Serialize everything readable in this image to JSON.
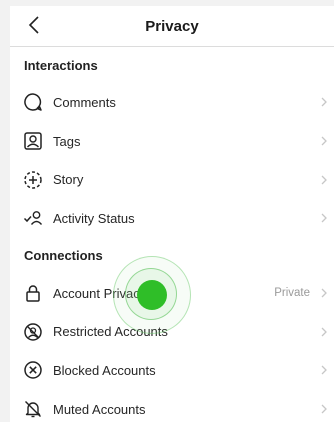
{
  "header": {
    "title": "Privacy"
  },
  "sections": [
    {
      "title": "Interactions",
      "items": [
        {
          "label": "Comments",
          "icon": "comment-bubble-icon"
        },
        {
          "label": "Tags",
          "icon": "tag-person-icon"
        },
        {
          "label": "Story",
          "icon": "story-plus-icon"
        },
        {
          "label": "Activity Status",
          "icon": "activity-status-icon"
        }
      ]
    },
    {
      "title": "Connections",
      "items": [
        {
          "label": "Account Privacy",
          "value": "Private",
          "icon": "lock-icon"
        },
        {
          "label": "Restricted Accounts",
          "icon": "restricted-icon"
        },
        {
          "label": "Blocked Accounts",
          "icon": "blocked-icon"
        },
        {
          "label": "Muted Accounts",
          "icon": "muted-bell-icon"
        }
      ]
    }
  ],
  "colors": {
    "touch_indicator": "#2fbe28",
    "chevron": "#c7c7c7",
    "value_text": "#9a9a9a"
  }
}
